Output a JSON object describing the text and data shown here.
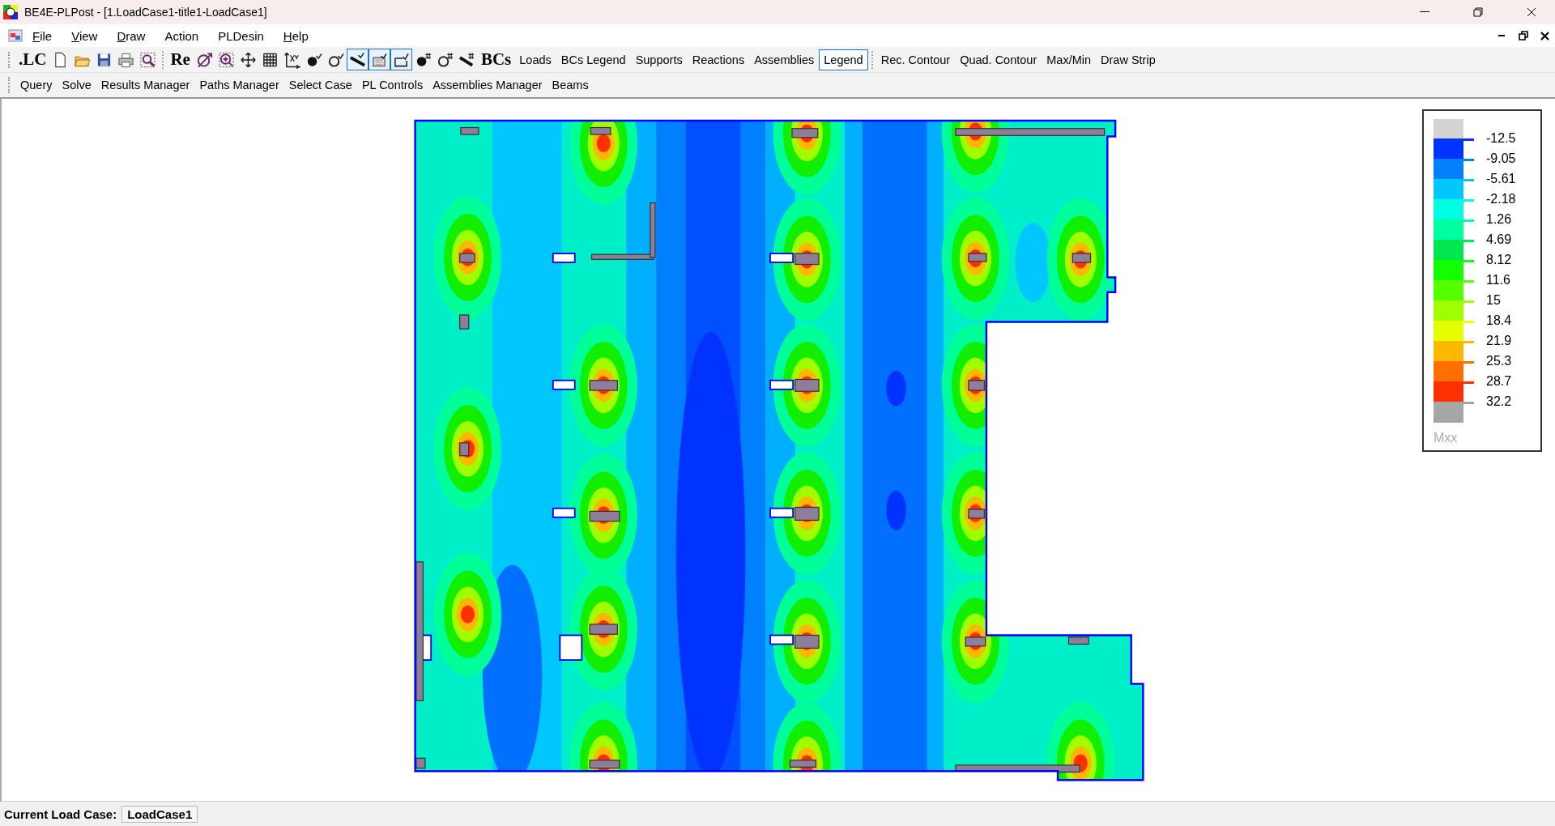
{
  "window": {
    "title": "BE4E-PLPost - [1.LoadCase1-title1-LoadCase1]"
  },
  "menu": [
    {
      "label": "File",
      "underlined": true
    },
    {
      "label": "View",
      "underlined": true
    },
    {
      "label": "Draw",
      "underlined": true
    },
    {
      "label": "Action",
      "underlined": false
    },
    {
      "label": "PLDesin",
      "underlined": false
    },
    {
      "label": "Help",
      "underlined": true
    }
  ],
  "toolbar": [
    {
      "kind": "bigtext",
      "label": ".LC"
    },
    {
      "kind": "icon",
      "selected": false
    },
    {
      "kind": "icon",
      "selected": false
    },
    {
      "kind": "icon",
      "selected": false
    },
    {
      "kind": "icon",
      "selected": false
    },
    {
      "kind": "icon",
      "selected": false
    },
    {
      "kind": "separator"
    },
    {
      "kind": "bigtext",
      "label": "Re"
    },
    {
      "kind": "icon",
      "selected": false
    },
    {
      "kind": "icon",
      "selected": false
    },
    {
      "kind": "icon",
      "selected": false
    },
    {
      "kind": "icon",
      "selected": false
    },
    {
      "kind": "icon",
      "selected": false
    },
    {
      "kind": "icon",
      "selected": false
    },
    {
      "kind": "icon",
      "selected": false
    },
    {
      "kind": "icon",
      "selected": true
    },
    {
      "kind": "icon",
      "selected": true
    },
    {
      "kind": "icon",
      "selected": true
    },
    {
      "kind": "icon",
      "selected": false
    },
    {
      "kind": "icon",
      "selected": false
    },
    {
      "kind": "icon",
      "selected": false
    },
    {
      "kind": "bigtext",
      "label": "BCs"
    },
    {
      "kind": "text",
      "label": "Loads",
      "selected": false
    },
    {
      "kind": "text",
      "label": "BCs Legend",
      "selected": false
    },
    {
      "kind": "text",
      "label": "Supports",
      "selected": false
    },
    {
      "kind": "text",
      "label": "Reactions",
      "selected": false
    },
    {
      "kind": "text",
      "label": "Assemblies",
      "selected": false
    },
    {
      "kind": "text",
      "label": "Legend",
      "selected": true
    },
    {
      "kind": "separator"
    },
    {
      "kind": "text",
      "label": "Rec. Contour",
      "selected": false
    },
    {
      "kind": "text",
      "label": "Quad. Contour",
      "selected": false
    },
    {
      "kind": "text",
      "label": "Max/Min",
      "selected": false
    },
    {
      "kind": "text",
      "label": "Draw Strip",
      "selected": false
    }
  ],
  "toolbar2": [
    "Query",
    "Solve",
    "Results Manager",
    "Paths Manager",
    "Select Case",
    "PL Controls",
    "Assemblies Manager",
    "Beams"
  ],
  "legend": {
    "title": "Mxx",
    "entries": [
      {
        "value": "-12.5",
        "color": "#0033ff"
      },
      {
        "value": "-9.05",
        "color": "#0080ff"
      },
      {
        "value": "-5.61",
        "color": "#00c8ff"
      },
      {
        "value": "-2.18",
        "color": "#00ffe0"
      },
      {
        "value": "1.26",
        "color": "#00ffa0"
      },
      {
        "value": "4.69",
        "color": "#00e650"
      },
      {
        "value": "8.12",
        "color": "#11ff00"
      },
      {
        "value": "11.6",
        "color": "#55ff00"
      },
      {
        "value": "15",
        "color": "#a0ff00"
      },
      {
        "value": "18.4",
        "color": "#e6ff00"
      },
      {
        "value": "21.9",
        "color": "#ffb800"
      },
      {
        "value": "25.3",
        "color": "#ff7000"
      },
      {
        "value": "28.7",
        "color": "#ff3000"
      },
      {
        "value": "32.2",
        "color": "#a6a6a6"
      }
    ]
  },
  "status_bar": {
    "label": "Current Load Case:",
    "value": "LoadCase1"
  }
}
